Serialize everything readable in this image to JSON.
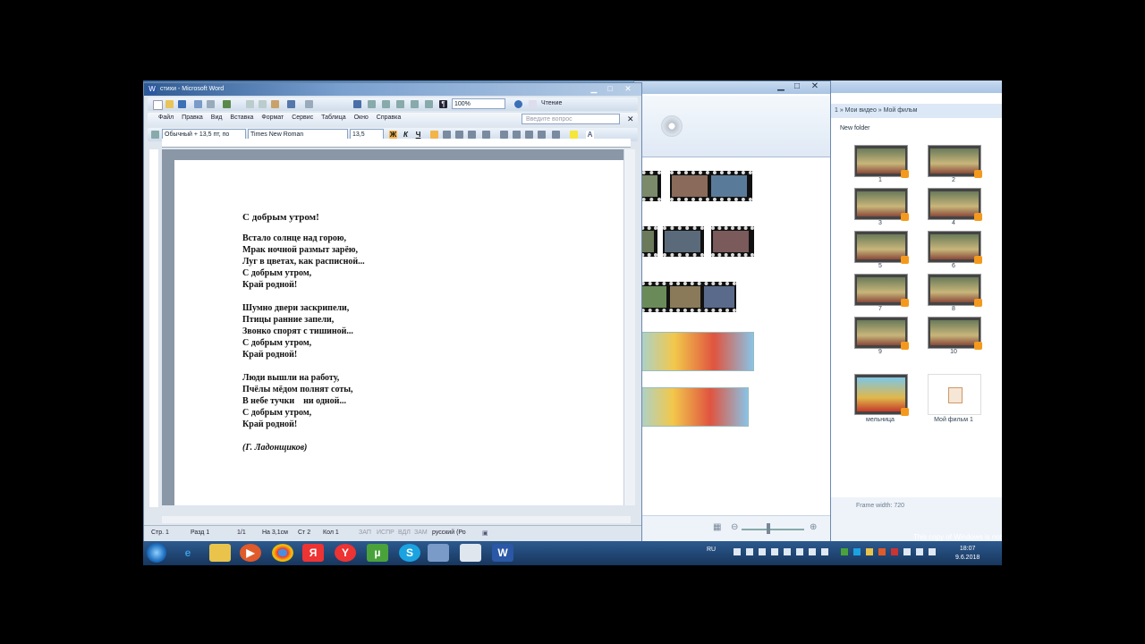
{
  "word": {
    "title": "стихи - Microsoft Word",
    "menu": [
      "Файл",
      "Правка",
      "Вид",
      "Вставка",
      "Формат",
      "Сервис",
      "Таблица",
      "Окно",
      "Справка"
    ],
    "zoom": "100%",
    "reading": "Чтение",
    "ask_placeholder": "Введите вопрос",
    "style": "Обычный + 13,5 пт, по",
    "font": "Times New Roman",
    "size": "13,5",
    "bold": "Ж",
    "italic": "К",
    "underline": "Ч",
    "poem": {
      "title": "С добрым утром!",
      "stanzas": [
        [
          "Встало солнце над горою,",
          "Мрак ночной размыт зарёю,",
          "Луг в цветах, как расписной...",
          "С добрым утром,",
          "Край родной!"
        ],
        [
          "Шумно двери заскрипели,",
          "Птицы ранние запели,",
          "Звонко спорят с тишиной...",
          "С добрым утром,",
          "Край родной!"
        ],
        [
          "Люди вышли на работу,",
          "Пчёлы мёдом полнят соты,",
          "В небе тучки    ни одной...",
          "С добрым утром,",
          "Край родной!"
        ]
      ],
      "author": "(Г. Ладонщиков)"
    },
    "status": {
      "page": "Стр. 1",
      "section": "Разд 1",
      "pages": "1/1",
      "pos": "На 3,1см",
      "line": "Ст 2",
      "col": "Кол 1",
      "rec": "ЗАП",
      "trk": "ИСПР",
      "ext": "ВДЛ",
      "ovr": "ЗАМ",
      "lang": "русский (Ро"
    }
  },
  "explorer": {
    "address": "1 » Мои видео » Мой фильм",
    "new_folder": "New folder",
    "thumb_labels": [
      "1",
      "2",
      "3",
      "4",
      "5",
      "6",
      "7",
      "8",
      "9",
      "10"
    ],
    "file1": "мельница",
    "file2": "Мой фильм 1",
    "status": "Frame width: 720"
  },
  "watermark": "This copy of Windows is not genuine",
  "clock": {
    "time": "18:07",
    "date": "9.6.2018"
  },
  "tray_lang": "RU",
  "taskbar_labels": {
    "yandex": "Я",
    "skype": "S"
  }
}
